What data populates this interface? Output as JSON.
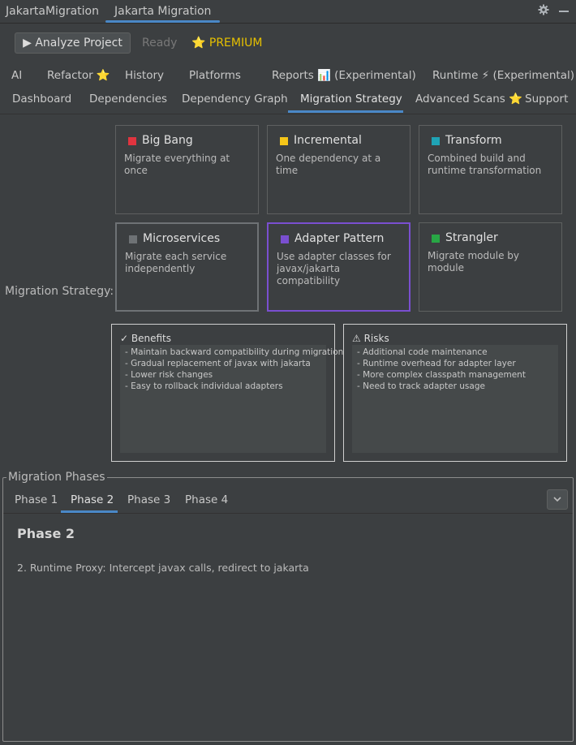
{
  "window": {
    "title": "JakartaMigration",
    "tool_tab": "Jakarta Migration",
    "settings_icon": "gear-icon",
    "minimize_icon": "minimize-icon"
  },
  "toolbar": {
    "analyze_label": "▶ Analyze Project",
    "status": "Ready",
    "premium": "⭐ PREMIUM",
    "premium_color": "#e6c000"
  },
  "tabs_row1": [
    "AI",
    "Refactor ⭐",
    "History",
    "Platforms",
    "Reports 📊 (Experimental)",
    "Runtime ⚡ (Experimental)"
  ],
  "tabs_row2": [
    "Dashboard",
    "Dependencies",
    "Dependency Graph",
    "Migration Strategy",
    "Advanced Scans ⭐",
    "Support"
  ],
  "active_tab": "Migration Strategy",
  "strategy": {
    "label": "Migration Strategy:",
    "cards": [
      {
        "title": "Big Bang",
        "desc": "Migrate everything at once",
        "color": "#e0343f"
      },
      {
        "title": "Incremental",
        "desc": "One dependency at a time",
        "color": "#f5c518"
      },
      {
        "title": "Transform",
        "desc": "Combined build and runtime transformation",
        "color": "#1fa3b5"
      },
      {
        "title": "Microservices",
        "desc": "Migrate each service independently",
        "color": "#6e7275"
      },
      {
        "title": "Adapter Pattern",
        "desc": "Use adapter classes for javax/jakarta compatibility",
        "color": "#7a4fd0"
      },
      {
        "title": "Strangler",
        "desc": "Migrate module by module",
        "color": "#28a745"
      }
    ],
    "selected": "Adapter Pattern"
  },
  "benefits": {
    "title": "✓ Benefits",
    "items": [
      "- Maintain backward compatibility during migration",
      "- Gradual replacement of javax with jakarta",
      "- Lower risk changes",
      "- Easy to rollback individual adapters"
    ]
  },
  "risks": {
    "title": "⚠ Risks",
    "items": [
      "- Additional code maintenance",
      "- Runtime overhead for adapter layer",
      "- More complex classpath management",
      "- Need to track adapter usage"
    ]
  },
  "phases": {
    "legend": "Migration Phases",
    "tabs": [
      "Phase 1",
      "Phase 2",
      "Phase 3",
      "Phase 4"
    ],
    "active": "Phase 2",
    "content_title": "Phase 2",
    "content_text": "2. Runtime Proxy: Intercept javax calls, redirect to jakarta",
    "dropdown_icon": "chevron-down-icon"
  }
}
